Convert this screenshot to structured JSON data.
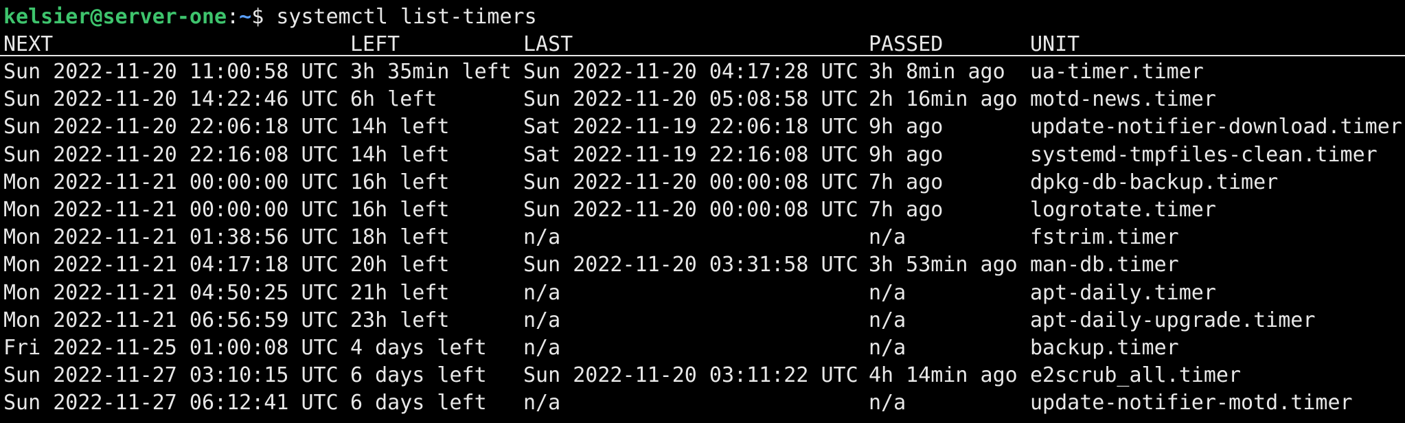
{
  "prompt": {
    "user_host": "kelsier@server-one",
    "separator": ":",
    "path": "~",
    "symbol": "$",
    "command": "systemctl list-timers"
  },
  "table": {
    "headers": [
      "NEXT",
      "LEFT",
      "LAST",
      "PASSED",
      "UNIT"
    ],
    "rows": [
      [
        "Sun 2022-11-20 11:00:58 UTC",
        "3h 35min left",
        "Sun 2022-11-20 04:17:28 UTC",
        "3h 8min ago",
        "ua-timer.timer"
      ],
      [
        "Sun 2022-11-20 14:22:46 UTC",
        "6h left",
        "Sun 2022-11-20 05:08:58 UTC",
        "2h 16min ago",
        "motd-news.timer"
      ],
      [
        "Sun 2022-11-20 22:06:18 UTC",
        "14h left",
        "Sat 2022-11-19 22:06:18 UTC",
        "9h ago",
        "update-notifier-download.timer"
      ],
      [
        "Sun 2022-11-20 22:16:08 UTC",
        "14h left",
        "Sat 2022-11-19 22:16:08 UTC",
        "9h ago",
        "systemd-tmpfiles-clean.timer"
      ],
      [
        "Mon 2022-11-21 00:00:00 UTC",
        "16h left",
        "Sun 2022-11-20 00:00:08 UTC",
        "7h ago",
        "dpkg-db-backup.timer"
      ],
      [
        "Mon 2022-11-21 00:00:00 UTC",
        "16h left",
        "Sun 2022-11-20 00:00:08 UTC",
        "7h ago",
        "logrotate.timer"
      ],
      [
        "Mon 2022-11-21 01:38:56 UTC",
        "18h left",
        "n/a",
        "n/a",
        "fstrim.timer"
      ],
      [
        "Mon 2022-11-21 04:17:18 UTC",
        "20h left",
        "Sun 2022-11-20 03:31:58 UTC",
        "3h 53min ago",
        "man-db.timer"
      ],
      [
        "Mon 2022-11-21 04:50:25 UTC",
        "21h left",
        "n/a",
        "n/a",
        "apt-daily.timer"
      ],
      [
        "Mon 2022-11-21 06:56:59 UTC",
        "23h left",
        "n/a",
        "n/a",
        "apt-daily-upgrade.timer"
      ],
      [
        "Fri 2022-11-25 01:00:08 UTC",
        "4 days left",
        "n/a",
        "n/a",
        "backup.timer"
      ],
      [
        "Sun 2022-11-27 03:10:15 UTC",
        "6 days left",
        "Sun 2022-11-20 03:11:22 UTC",
        "4h 14min ago",
        "e2scrub_all.timer"
      ],
      [
        "Sun 2022-11-27 06:12:41 UTC",
        "6 days left",
        "n/a",
        "n/a",
        "update-notifier-motd.timer"
      ]
    ]
  },
  "colors": {
    "background": "#000000",
    "text": "#e8e8e8",
    "prompt_user": "#3ec46d",
    "prompt_path": "#5aa0ff"
  }
}
